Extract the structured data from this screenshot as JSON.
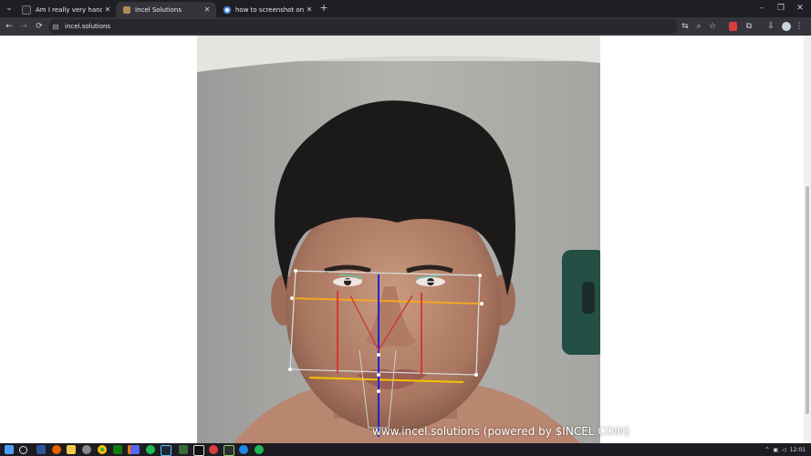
{
  "tabs": [
    {
      "title": "Am I really very handsome? | Lo",
      "favicon_color": "#2b2b2b",
      "active": false
    },
    {
      "title": "Incel Solutions",
      "favicon_color": "#b08d57",
      "active": true
    },
    {
      "title": "how to screenshot on windows",
      "favicon_color": "#4285f4",
      "active": false
    }
  ],
  "toolbar": {
    "url": "incel.solutions",
    "new_tab_glyph": "+",
    "back_glyph": "←",
    "forward_glyph": "→",
    "reload_glyph": "⟳",
    "site_info_glyph": "⊟",
    "translate_glyph": "⇆",
    "zoom_glyph": "⌕",
    "bookmark_glyph": "☆",
    "extension_glyph": "⧉",
    "download_glyph": "⇩",
    "menu_glyph": "⋮",
    "minimize_glyph": "–",
    "restore_glyph": "❐",
    "close_glyph": "✕",
    "tab_search_glyph": "⌄"
  },
  "page": {
    "watermark": "www.incel.solutions (powered by $INCEL COIN)"
  },
  "taskbar": {
    "time": "12:01",
    "icons": [
      "windows",
      "search",
      "widgets",
      "word",
      "firefox",
      "folder",
      "settings",
      "chrome",
      "xbox",
      "taskview",
      "discord",
      "spotify",
      "steam",
      "star",
      "tiktok",
      "terminal",
      "mail",
      "shield",
      "monitor",
      "spotify2"
    ]
  }
}
